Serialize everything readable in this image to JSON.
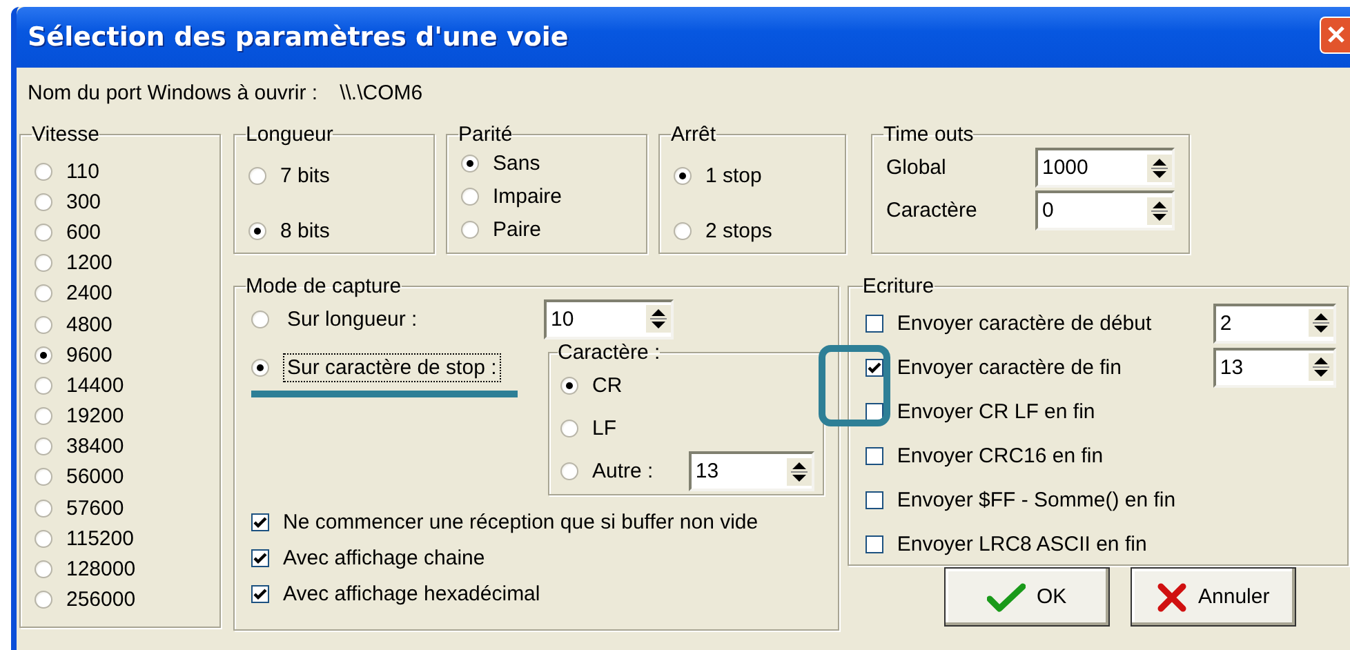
{
  "window": {
    "title": "Sélection des paramètres d'une voie"
  },
  "port": {
    "label": "Nom du port Windows à ouvrir :",
    "value": "\\\\.\\COM6"
  },
  "vitesse": {
    "title": "Vitesse",
    "options": [
      {
        "label": "110",
        "selected": false
      },
      {
        "label": "300",
        "selected": false
      },
      {
        "label": "600",
        "selected": false
      },
      {
        "label": "1200",
        "selected": false
      },
      {
        "label": "2400",
        "selected": false
      },
      {
        "label": "4800",
        "selected": false
      },
      {
        "label": "9600",
        "selected": true
      },
      {
        "label": "14400",
        "selected": false
      },
      {
        "label": "19200",
        "selected": false
      },
      {
        "label": "38400",
        "selected": false
      },
      {
        "label": "56000",
        "selected": false
      },
      {
        "label": "57600",
        "selected": false
      },
      {
        "label": "115200",
        "selected": false
      },
      {
        "label": "128000",
        "selected": false
      },
      {
        "label": "256000",
        "selected": false
      }
    ]
  },
  "longueur": {
    "title": "Longueur",
    "options": [
      {
        "label": "7 bits",
        "selected": false
      },
      {
        "label": "8 bits",
        "selected": true
      }
    ]
  },
  "parite": {
    "title": "Parité",
    "options": [
      {
        "label": "Sans",
        "selected": true
      },
      {
        "label": "Impaire",
        "selected": false
      },
      {
        "label": "Paire",
        "selected": false
      }
    ]
  },
  "arret": {
    "title": "Arrêt",
    "options": [
      {
        "label": "1 stop",
        "selected": true
      },
      {
        "label": "2 stops",
        "selected": false
      }
    ]
  },
  "time_outs": {
    "title": "Time outs",
    "fields": [
      {
        "label": "Global",
        "value": "1000"
      },
      {
        "label": "Caractère",
        "value": "0"
      }
    ]
  },
  "mode_capture": {
    "title": "Mode de capture",
    "options": [
      {
        "label": "Sur longueur :",
        "selected": false,
        "focused": false,
        "value": "10"
      },
      {
        "label": "Sur caractère de stop :",
        "selected": true,
        "focused": true
      }
    ],
    "caractere": {
      "title": "Caractère :",
      "options": [
        {
          "label": "CR",
          "selected": true
        },
        {
          "label": "LF",
          "selected": false
        },
        {
          "label": "Autre :",
          "selected": false,
          "value": "13"
        }
      ]
    },
    "checks": [
      {
        "label": "Ne commencer une réception que si buffer non vide",
        "checked": true
      },
      {
        "label": "Avec affichage chaine",
        "checked": true
      },
      {
        "label": "Avec affichage hexadécimal",
        "checked": true
      }
    ]
  },
  "ecriture": {
    "title": "Ecriture",
    "options": [
      {
        "label": "Envoyer caractère de début",
        "checked": false,
        "value": "2"
      },
      {
        "label": "Envoyer caractère de fin",
        "checked": true,
        "value": "13"
      },
      {
        "label": "Envoyer CR LF en fin",
        "checked": false
      },
      {
        "label": "Envoyer CRC16 en fin",
        "checked": false
      },
      {
        "label": "Envoyer $FF - Somme() en fin",
        "checked": false
      },
      {
        "label": "Envoyer LRC8 ASCII en fin",
        "checked": false
      }
    ]
  },
  "buttons": [
    {
      "kind": "ok",
      "label": "OK"
    },
    {
      "kind": "cancel",
      "label": "Annuler"
    }
  ]
}
